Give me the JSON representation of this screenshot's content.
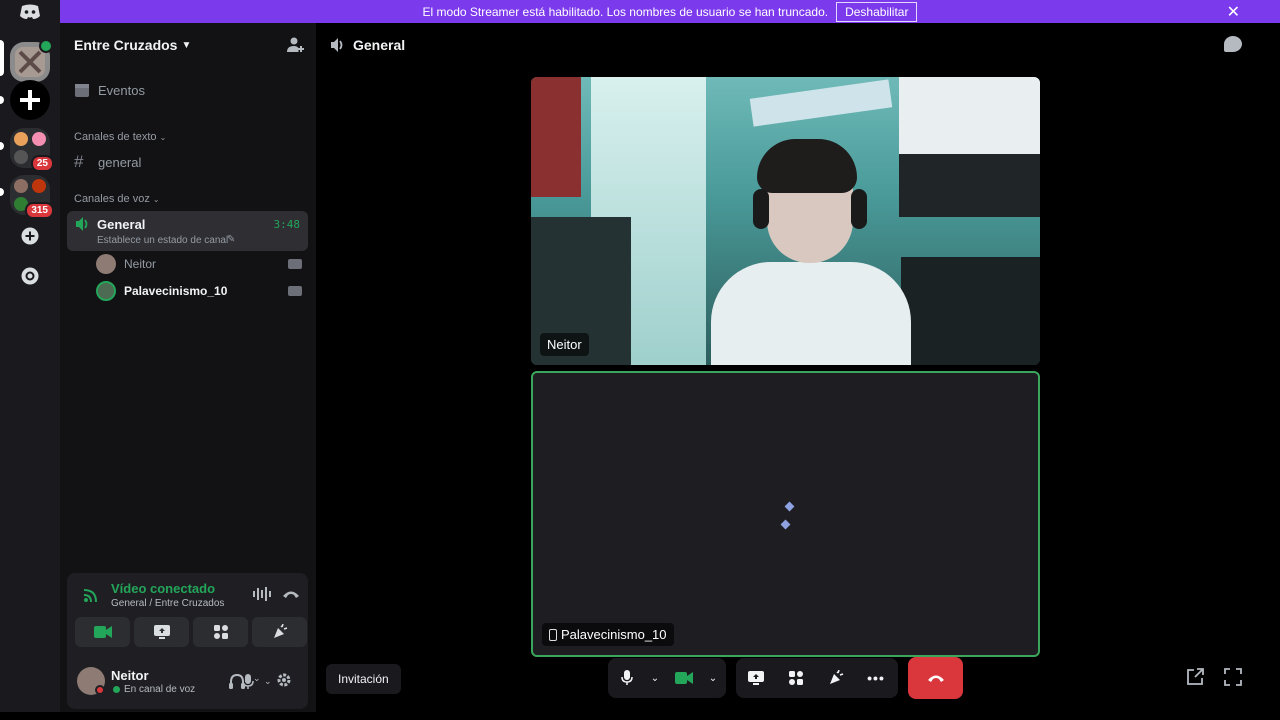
{
  "banner": {
    "text": "El modo Streamer está habilitado. Los nombres de usuario se han truncado.",
    "button_label": "Deshabilitar"
  },
  "rail": {
    "badges": [
      "25",
      "315"
    ]
  },
  "sidebar": {
    "server_name": "Entre Cruzados",
    "events_label": "Eventos",
    "text_category": "Canales de texto",
    "text_channels": [
      {
        "name": "general"
      }
    ],
    "voice_category": "Canales de voz",
    "voice_channel": {
      "name": "General",
      "status": "Establece un estado de canal",
      "timer": "3:48"
    },
    "members": [
      {
        "name": "Neitor"
      },
      {
        "name": "Palavecinismo_10"
      }
    ]
  },
  "voice_panel": {
    "title": "Vídeo conectado",
    "subtitle": "General / Entre Cruzados"
  },
  "user_panel": {
    "name": "Neitor",
    "status": "En canal de voz"
  },
  "main": {
    "channel_name": "General",
    "tiles": [
      {
        "name": "Neitor"
      },
      {
        "name": "Palavecinismo_10"
      }
    ],
    "invite_label": "Invitación"
  },
  "colors": {
    "brand": "#5865f2",
    "banner": "#7c3aed",
    "connected_green": "#23a55a",
    "danger_red": "#da373c"
  }
}
